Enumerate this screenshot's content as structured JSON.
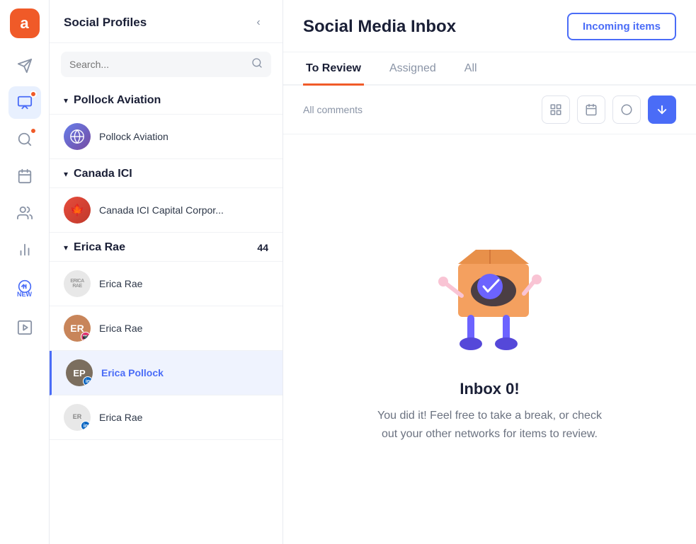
{
  "app": {
    "logo_letter": "a"
  },
  "nav": {
    "items": [
      {
        "name": "send-icon",
        "icon": "✈",
        "active": false,
        "badge": false
      },
      {
        "name": "inbox-icon",
        "icon": "🖼",
        "active": true,
        "badge": true
      },
      {
        "name": "search-icon",
        "icon": "🌐",
        "active": false,
        "badge": true
      },
      {
        "name": "calendar-icon",
        "icon": "📅",
        "active": false,
        "badge": false
      },
      {
        "name": "team-icon",
        "icon": "👥",
        "active": false,
        "badge": false
      },
      {
        "name": "analytics-icon",
        "icon": "📈",
        "active": false,
        "badge": false
      },
      {
        "name": "speedometer-icon",
        "icon": "🏎",
        "active": false,
        "badge": false,
        "new": true
      },
      {
        "name": "media-icon",
        "icon": "▶",
        "active": false,
        "badge": false
      }
    ]
  },
  "sidebar": {
    "title": "Social Profiles",
    "search_placeholder": "Search...",
    "collapse_icon": "‹",
    "groups": [
      {
        "name": "Pollock Aviation",
        "count": "",
        "profiles": [
          {
            "name": "Pollock Aviation",
            "platform": "globe",
            "selected": false
          }
        ]
      },
      {
        "name": "Canada ICI",
        "count": "",
        "profiles": [
          {
            "name": "Canada ICI Capital Corpor...",
            "platform": "red",
            "selected": false
          }
        ]
      },
      {
        "name": "Erica Rae",
        "count": "44",
        "profiles": [
          {
            "name": "Erica Rae",
            "platform": "none",
            "avatar_text": "ERICARAE",
            "selected": false
          },
          {
            "name": "Erica Rae",
            "platform": "red",
            "avatar_text": "ER",
            "selected": false
          },
          {
            "name": "Erica Pollock",
            "platform": "linkedin",
            "avatar_text": "EP",
            "selected": true
          },
          {
            "name": "Erica Rae",
            "platform": "linkedin",
            "avatar_text": "ER",
            "selected": false
          }
        ]
      }
    ]
  },
  "main": {
    "title": "Social Media Inbox",
    "incoming_btn": "Incoming items",
    "tabs": [
      {
        "label": "To Review",
        "active": true
      },
      {
        "label": "Assigned",
        "active": false
      },
      {
        "label": "All",
        "active": false
      }
    ],
    "filter_label": "All comments",
    "filter_buttons": [
      {
        "name": "filter-layout",
        "icon": "⊟"
      },
      {
        "name": "filter-calendar",
        "icon": "📆"
      },
      {
        "name": "filter-check",
        "icon": "○"
      },
      {
        "name": "filter-sort",
        "icon": "↕"
      }
    ],
    "inbox_zero": {
      "title": "Inbox 0!",
      "description": "You did it! Feel free to take a break, or check out your other networks for items to review."
    }
  }
}
